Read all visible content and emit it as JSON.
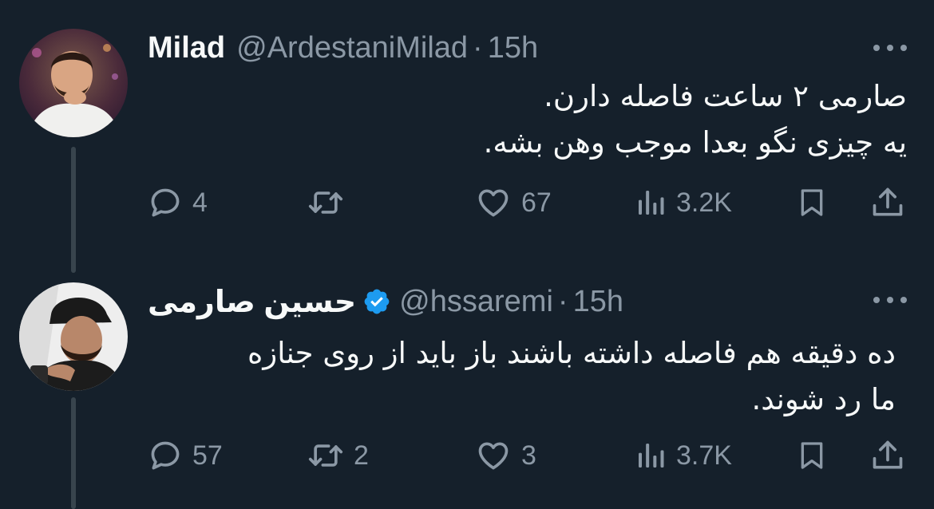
{
  "tweets": [
    {
      "display_name": "Milad",
      "handle": "@ArdestaniMilad",
      "separator": "·",
      "time": "15h",
      "verified": false,
      "text_lines": [
        "صارمی ۲ ساعت فاصله دارن.",
        "یه چیزی نگو بعدا موجب وهن بشه."
      ],
      "stats": {
        "replies": "4",
        "retweets": "",
        "likes": "67",
        "views": "3.2K"
      }
    },
    {
      "display_name": "حسین صارمی",
      "handle": "@hssaremi",
      "separator": "·",
      "time": "15h",
      "verified": true,
      "text_lines": [
        "ده دقیقه هم فاصله داشته باشند باز باید از روی جنازه",
        "ما رد شوند."
      ],
      "stats": {
        "replies": "57",
        "retweets": "2",
        "likes": "3",
        "views": "3.7K"
      }
    }
  ],
  "icons": {
    "reply": "reply-icon",
    "retweet": "retweet-icon",
    "like": "heart-icon",
    "views": "views-icon",
    "bookmark": "bookmark-icon",
    "share": "share-icon",
    "more": "more-icon",
    "verified": "verified-badge-icon"
  },
  "colors": {
    "background": "#15202b",
    "text_primary": "#f7f9f9",
    "text_secondary": "#8b98a5",
    "verified": "#1d9bf0"
  }
}
